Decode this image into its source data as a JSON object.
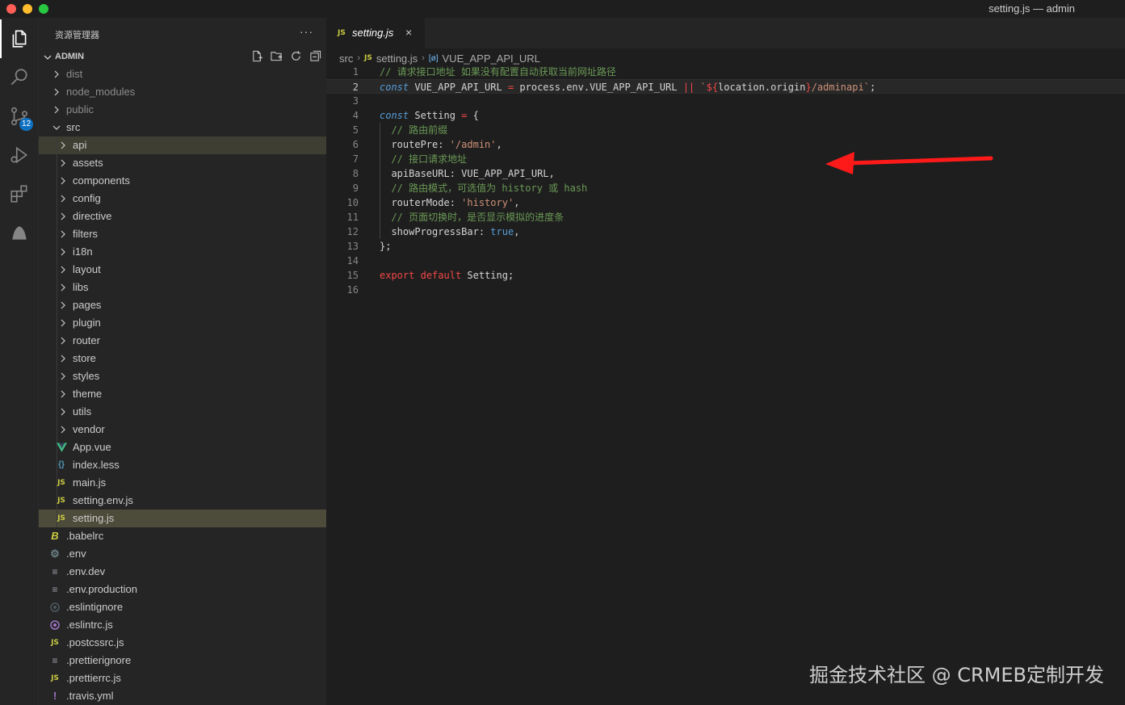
{
  "window": {
    "title": "setting.js — admin"
  },
  "activity_bar": {
    "items": [
      {
        "name": "explorer-icon",
        "active": true
      },
      {
        "name": "search-icon"
      },
      {
        "name": "source-control-icon",
        "badge": "12"
      },
      {
        "name": "run-debug-icon"
      },
      {
        "name": "extensions-icon"
      },
      {
        "name": "sidebar-extension-icon"
      }
    ]
  },
  "sidebar": {
    "title": "资源管理器",
    "more": "···",
    "section_title": "ADMIN",
    "actions": [
      "new-file-icon",
      "new-folder-icon",
      "refresh-icon",
      "collapse-all-icon"
    ],
    "tree": [
      {
        "label": "dist",
        "type": "folder",
        "depth": 0,
        "open": false
      },
      {
        "label": "node_modules",
        "type": "folder",
        "depth": 0,
        "open": false
      },
      {
        "label": "public",
        "type": "folder",
        "depth": 0,
        "open": false
      },
      {
        "label": "src",
        "type": "folder",
        "depth": 0,
        "open": true
      },
      {
        "label": "api",
        "type": "folder",
        "depth": 1,
        "open": false,
        "state": "hl"
      },
      {
        "label": "assets",
        "type": "folder",
        "depth": 1,
        "open": false
      },
      {
        "label": "components",
        "type": "folder",
        "depth": 1,
        "open": false
      },
      {
        "label": "config",
        "type": "folder",
        "depth": 1,
        "open": false
      },
      {
        "label": "directive",
        "type": "folder",
        "depth": 1,
        "open": false
      },
      {
        "label": "filters",
        "type": "folder",
        "depth": 1,
        "open": false
      },
      {
        "label": "i18n",
        "type": "folder",
        "depth": 1,
        "open": false
      },
      {
        "label": "layout",
        "type": "folder",
        "depth": 1,
        "open": false
      },
      {
        "label": "libs",
        "type": "folder",
        "depth": 1,
        "open": false
      },
      {
        "label": "pages",
        "type": "folder",
        "depth": 1,
        "open": false
      },
      {
        "label": "plugin",
        "type": "folder",
        "depth": 1,
        "open": false
      },
      {
        "label": "router",
        "type": "folder",
        "depth": 1,
        "open": false
      },
      {
        "label": "store",
        "type": "folder",
        "depth": 1,
        "open": false
      },
      {
        "label": "styles",
        "type": "folder",
        "depth": 1,
        "open": false
      },
      {
        "label": "theme",
        "type": "folder",
        "depth": 1,
        "open": false
      },
      {
        "label": "utils",
        "type": "folder",
        "depth": 1,
        "open": false
      },
      {
        "label": "vendor",
        "type": "folder",
        "depth": 1,
        "open": false
      },
      {
        "label": "App.vue",
        "type": "vue",
        "depth": 1
      },
      {
        "label": "index.less",
        "type": "less",
        "depth": 1
      },
      {
        "label": "main.js",
        "type": "js",
        "depth": 1
      },
      {
        "label": "setting.env.js",
        "type": "js",
        "depth": 1
      },
      {
        "label": "setting.js",
        "type": "js",
        "depth": 1,
        "state": "active"
      },
      {
        "label": ".babelrc",
        "type": "babel",
        "depth": 0
      },
      {
        "label": ".env",
        "type": "gear",
        "depth": 0
      },
      {
        "label": ".env.dev",
        "type": "lines",
        "depth": 0
      },
      {
        "label": ".env.production",
        "type": "lines",
        "depth": 0
      },
      {
        "label": ".eslintignore",
        "type": "eslint-dim",
        "depth": 0
      },
      {
        "label": ".eslintrc.js",
        "type": "eslint",
        "depth": 0
      },
      {
        "label": ".postcssrc.js",
        "type": "js",
        "depth": 0
      },
      {
        "label": ".prettierignore",
        "type": "lines",
        "depth": 0
      },
      {
        "label": ".prettierrc.js",
        "type": "js",
        "depth": 0
      },
      {
        "label": ".travis.yml",
        "type": "yml",
        "depth": 0
      }
    ]
  },
  "editor": {
    "tab": {
      "label": "setting.js",
      "icon": "JS",
      "close": "×"
    },
    "breadcrumb": {
      "parts": [
        "src",
        "setting.js",
        "VUE_APP_API_URL"
      ],
      "js_icon": "JS",
      "symbol_icon": "[ø]"
    },
    "lines": [
      {
        "n": "1",
        "tokens": [
          [
            "cm",
            "// 请求接口地址 如果没有配置自动获取当前网址路径"
          ]
        ]
      },
      {
        "n": "2",
        "current": true,
        "tokens": [
          [
            "kw",
            "const"
          ],
          [
            "punc",
            " VUE_APP_API_URL "
          ],
          [
            "ex",
            "="
          ],
          [
            "punc",
            " process.env.VUE_APP_API_URL "
          ],
          [
            "ex",
            "||"
          ],
          [
            "punc",
            " "
          ],
          [
            "tpl",
            "`"
          ],
          [
            "ex",
            "${"
          ],
          [
            "punc",
            "location.origin"
          ],
          [
            "ex",
            "}"
          ],
          [
            "tpl",
            "/adminapi`"
          ],
          [
            "punc",
            ";"
          ]
        ]
      },
      {
        "n": "3",
        "tokens": []
      },
      {
        "n": "4",
        "tokens": [
          [
            "kw",
            "const"
          ],
          [
            "punc",
            " Setting "
          ],
          [
            "ex",
            "="
          ],
          [
            "punc",
            " {"
          ]
        ]
      },
      {
        "n": "5",
        "indent": true,
        "tokens": [
          [
            "cm",
            "  // 路由前缀"
          ]
        ]
      },
      {
        "n": "6",
        "indent": true,
        "tokens": [
          [
            "punc",
            "  routePre: "
          ],
          [
            "str",
            "'/admin'"
          ],
          [
            "punc",
            ","
          ]
        ]
      },
      {
        "n": "7",
        "indent": true,
        "tokens": [
          [
            "cm",
            "  // 接口请求地址"
          ]
        ]
      },
      {
        "n": "8",
        "indent": true,
        "tokens": [
          [
            "punc",
            "  apiBaseURL: VUE_APP_API_URL,"
          ]
        ]
      },
      {
        "n": "9",
        "indent": true,
        "tokens": [
          [
            "cm",
            "  // 路由模式，可选值为 history 或 hash"
          ]
        ]
      },
      {
        "n": "10",
        "indent": true,
        "tokens": [
          [
            "punc",
            "  routerMode: "
          ],
          [
            "str",
            "'history'"
          ],
          [
            "punc",
            ","
          ]
        ]
      },
      {
        "n": "11",
        "indent": true,
        "tokens": [
          [
            "cm",
            "  // 页面切换时，是否显示模拟的进度条"
          ]
        ]
      },
      {
        "n": "12",
        "indent": true,
        "tokens": [
          [
            "punc",
            "  showProgressBar: "
          ],
          [
            "bool",
            "true"
          ],
          [
            "punc",
            ","
          ]
        ]
      },
      {
        "n": "13",
        "tokens": [
          [
            "punc",
            "};"
          ]
        ]
      },
      {
        "n": "14",
        "tokens": []
      },
      {
        "n": "15",
        "tokens": [
          [
            "ex",
            "export"
          ],
          [
            "punc",
            " "
          ],
          [
            "ex",
            "default"
          ],
          [
            "punc",
            " Setting;"
          ]
        ]
      },
      {
        "n": "16",
        "tokens": []
      }
    ]
  },
  "annotation": {
    "arrow_color": "#ff1a1a",
    "points_to_line": "6"
  },
  "watermark": "掘金技术社区 @ CRMEB定制开发"
}
